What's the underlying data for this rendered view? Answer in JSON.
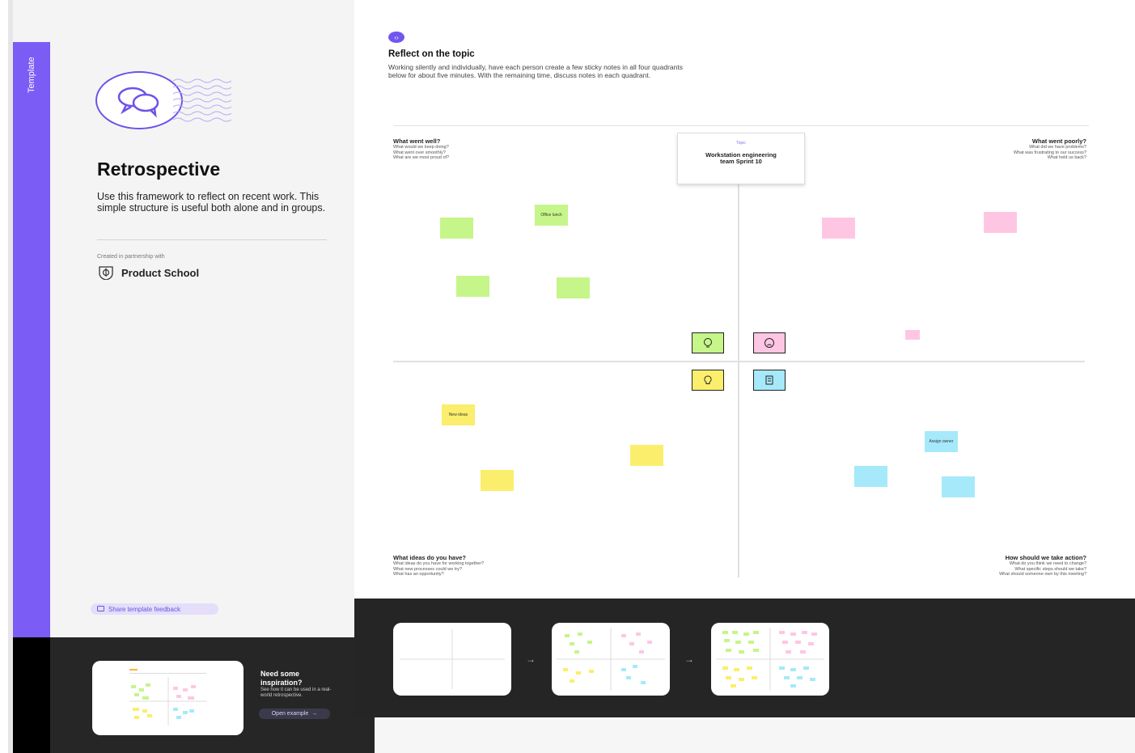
{
  "sidebar": {
    "tab_label": "Template",
    "title": "Retrospective",
    "description": "Use this framework to reflect on recent work. This simple structure is useful both alone and in groups.",
    "created_with_label": "Created in partnership with",
    "brand_name": "Product School",
    "feedback_button": "Share template feedback",
    "inspiration": {
      "title": "Need some inspiration?",
      "body": "See how it can be used in a real-world retrospective.",
      "button": "Open example"
    }
  },
  "board": {
    "step_icon": "arrow-right-icon",
    "title": "Reflect on the topic",
    "description": "Working silently and individually, have each person create a few sticky notes in all four quadrants below for about five minutes. With the remaining time, discuss notes in each quadrant.",
    "center_card": {
      "kicker": "Topic",
      "text": "Workstation engineering team Sprint 10"
    },
    "quadrants": [
      {
        "title": "What went well?",
        "subs": [
          "What would we keep doing?",
          "What went over smoothly?",
          "What are we most proud of?"
        ]
      },
      {
        "title": "What went poorly?",
        "subs": [
          "What did we have problems?",
          "What was frustrating to our success?",
          "What held us back?"
        ]
      },
      {
        "title": "What ideas do you have?",
        "subs": [
          "What ideas do you have for working together?",
          "What new processes could we try?",
          "What has an opportunity?"
        ]
      },
      {
        "title": "How should we take action?",
        "subs": [
          "What do you think we need to change?",
          "What specific steps should we take?",
          "What should someone own by this meeting?"
        ]
      }
    ],
    "sticky_texts": {
      "green_label": "Office lunch",
      "yellow_label": "New ideas",
      "blue_label": "Assign owner"
    },
    "colors": {
      "green": "#c6f58a",
      "pink": "#ffc6e4",
      "yellow": "#fbee6c",
      "blue": "#a6e9fa",
      "accent": "#7b5cf5"
    }
  }
}
